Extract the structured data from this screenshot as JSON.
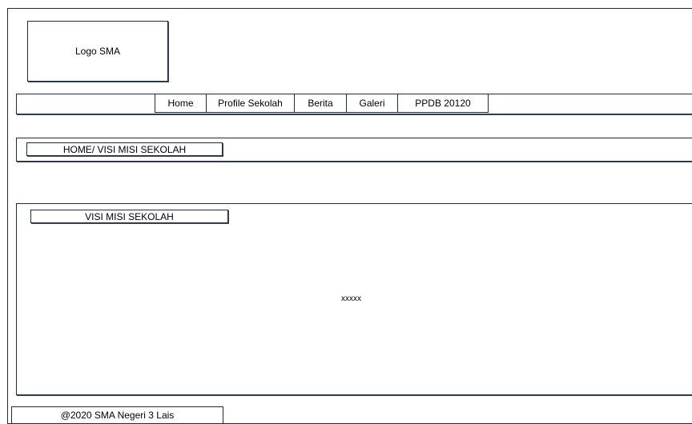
{
  "header": {
    "logo_text": "Logo SMA"
  },
  "nav": {
    "items": [
      {
        "label": "Home"
      },
      {
        "label": "Profile Sekolah"
      },
      {
        "label": "Berita"
      },
      {
        "label": "Galeri"
      },
      {
        "label": "PPDB 20120"
      }
    ]
  },
  "breadcrumb": {
    "text": "HOME/ VISI MISI SEKOLAH"
  },
  "main": {
    "section_title": "VISI MISI SEKOLAH",
    "content_text": "xxxxx"
  },
  "footer": {
    "text": "@2020 SMA Negeri 3 Lais"
  }
}
